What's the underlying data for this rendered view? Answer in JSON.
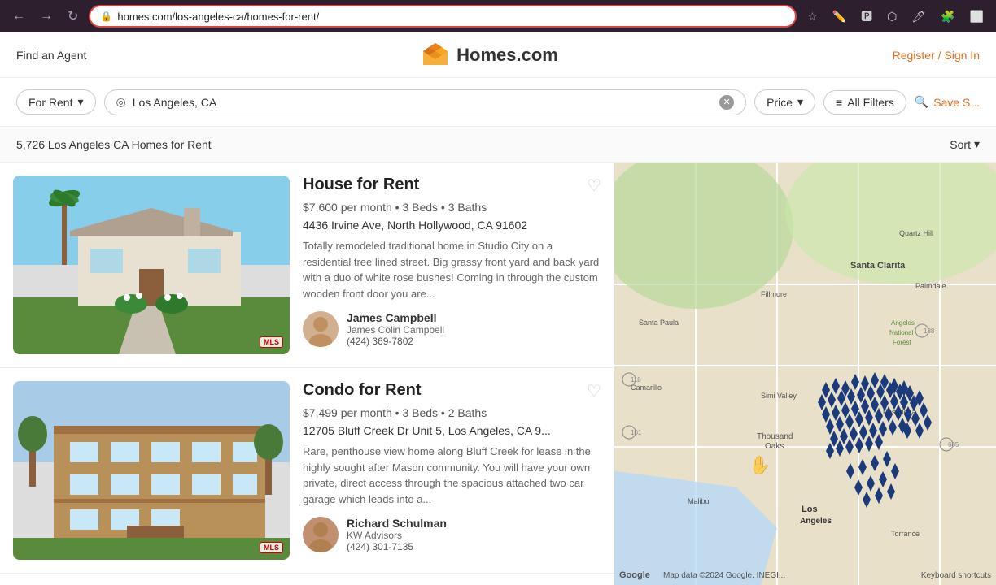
{
  "browser": {
    "url": "homes.com/los-angeles-ca/homes-for-rent/",
    "back_title": "Back",
    "forward_title": "Forward",
    "refresh_title": "Refresh"
  },
  "header": {
    "find_agent": "Find an Agent",
    "logo_text": "Homes.com",
    "register": "Register / Sign In"
  },
  "search": {
    "for_rent_label": "For Rent",
    "location_value": "Los Angeles, CA",
    "price_label": "Price",
    "all_filters_label": "All Filters",
    "save_search_label": "Save S..."
  },
  "results": {
    "count_text": "5,726 Los Angeles CA Homes for Rent",
    "sort_label": "Sort"
  },
  "listings": [
    {
      "type": "House for Rent",
      "price": "$7,600 per month",
      "beds": "3 Beds",
      "baths": "3 Baths",
      "address": "4436 Irvine Ave, North Hollywood, CA 91602",
      "description": "Totally remodeled traditional home in Studio City on a residential tree lined street. Big grassy front yard and back yard with a duo of white rose bushes! Coming in through the custom wooden front door you are...",
      "agent_name": "James Campbell",
      "agent_company": "James Colin Campbell",
      "agent_phone": "(424) 369-7802",
      "mls_badge": "MLS"
    },
    {
      "type": "Condo for Rent",
      "price": "$7,499 per month",
      "beds": "3 Beds",
      "baths": "2 Baths",
      "address": "12705 Bluff Creek Dr Unit 5, Los Angeles, CA 9...",
      "description": "Rare, penthouse view home along Bluff Creek for lease in the highly sought after Mason community. You will have your own private, direct access through the spacious attached two car garage which leads into a...",
      "agent_name": "Richard Schulman",
      "agent_company": "KW Advisors",
      "agent_phone": "(424) 301-7135",
      "mls_badge": "MLS"
    }
  ],
  "map": {
    "google_text": "Google",
    "keyboard_shortcuts": "Keyboard shortcuts",
    "map_data": "Map data ©2024 Google, INEGI..."
  },
  "icons": {
    "back": "←",
    "forward": "→",
    "refresh": "↻",
    "shield": "🔒",
    "star": "☆",
    "chevron_down": "▾",
    "target": "◎",
    "sliders": "⚙",
    "search": "🔍",
    "heart_empty": "♡",
    "pin": "📍"
  }
}
